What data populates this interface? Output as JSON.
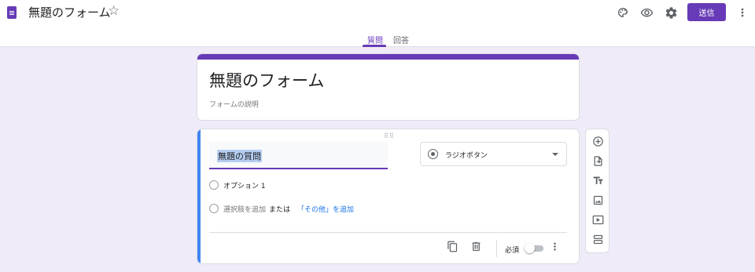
{
  "header": {
    "app_title": "無題のフォーム",
    "send_label": "送信",
    "icons": [
      "doc-icon",
      "star-icon",
      "palette-icon",
      "eye-icon",
      "gear-icon",
      "more-vert-icon"
    ]
  },
  "tabs": [
    {
      "label": "質問",
      "active": true
    },
    {
      "label": "回答",
      "active": false
    }
  ],
  "form": {
    "title": "無題のフォーム",
    "description_placeholder": "フォームの説明"
  },
  "question": {
    "title": "無題の質問",
    "type": "ラジオボタン",
    "options": [
      "オプション 1"
    ],
    "add_option": "選択肢を追加",
    "or": "または",
    "add_other": "「その他」を追加",
    "required_label": "必須",
    "required": false
  },
  "side_toolbar": [
    "add-question-icon",
    "import-icon",
    "title-text-icon",
    "image-icon",
    "video-icon",
    "section-icon"
  ],
  "colors": {
    "accent": "#673ab7",
    "background": "#f0ebf8",
    "focus_stripe": "#4285f4",
    "link": "#1a73e8"
  }
}
